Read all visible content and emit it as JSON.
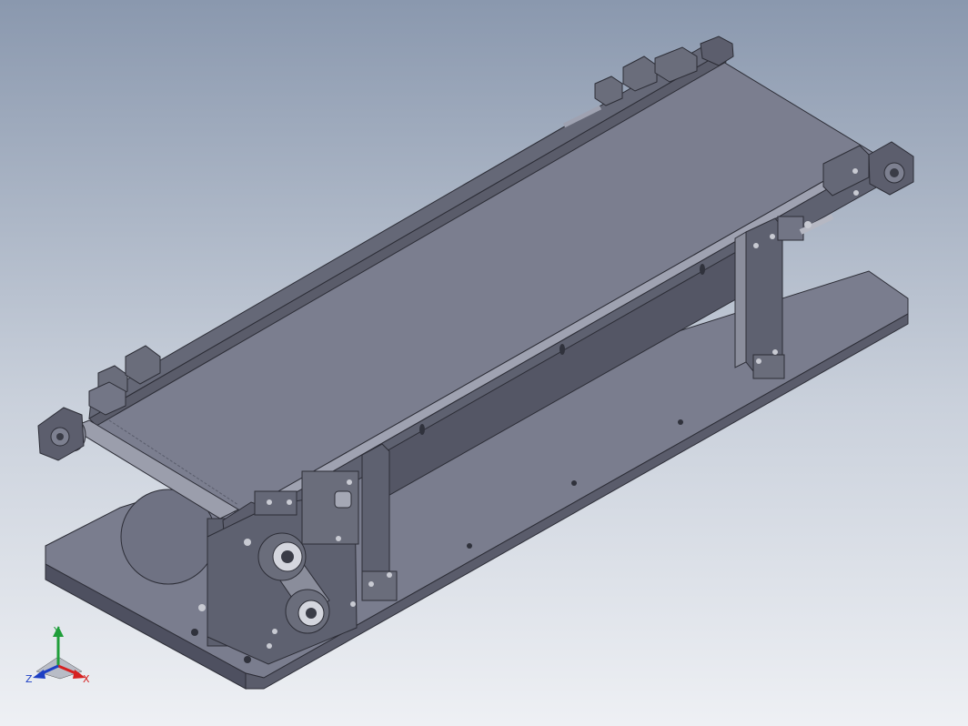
{
  "viewport": {
    "background_top": "#8a98ae",
    "background_bottom": "#eef0f4"
  },
  "model": {
    "colors": {
      "base_top": "#7a7d8e",
      "base_side": "#4e5060",
      "belt": "#7b7e8f",
      "frame_dark": "#545665",
      "frame_mid": "#656877",
      "edge": "#2c2d36",
      "motor": "#6f7283"
    }
  },
  "triad": {
    "labels": {
      "x": "X",
      "y": "Y",
      "z": "Z"
    },
    "colors": {
      "x": "#d62020",
      "y": "#1f9e3a",
      "z": "#1d3fc4"
    }
  }
}
